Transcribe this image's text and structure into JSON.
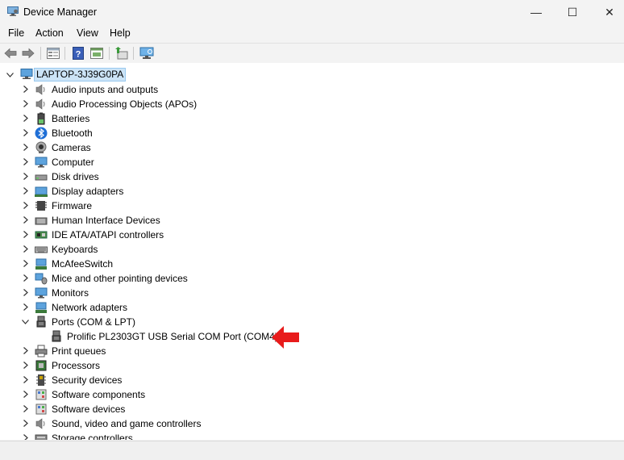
{
  "window": {
    "title": "Device Manager",
    "minimize": "—",
    "maximize": "☐",
    "close": "✕"
  },
  "menu": [
    "File",
    "Action",
    "View",
    "Help"
  ],
  "toolbar": [
    "back-icon",
    "forward-icon",
    "properties-icon",
    "help-icon",
    "driver-icon",
    "update-driver-icon",
    "scan-hardware-icon"
  ],
  "tree": {
    "root": "LAPTOP-3J39G0PA",
    "categories": [
      {
        "label": "Audio inputs and outputs",
        "icon": "speaker-icon",
        "expanded": false
      },
      {
        "label": "Audio Processing Objects (APOs)",
        "icon": "speaker-icon",
        "expanded": false
      },
      {
        "label": "Batteries",
        "icon": "battery-icon",
        "expanded": false
      },
      {
        "label": "Bluetooth",
        "icon": "bluetooth-icon",
        "expanded": false
      },
      {
        "label": "Cameras",
        "icon": "camera-icon",
        "expanded": false
      },
      {
        "label": "Computer",
        "icon": "monitor-icon",
        "expanded": false
      },
      {
        "label": "Disk drives",
        "icon": "disk-icon",
        "expanded": false
      },
      {
        "label": "Display adapters",
        "icon": "display-adapter-icon",
        "expanded": false
      },
      {
        "label": "Firmware",
        "icon": "chip-icon",
        "expanded": false
      },
      {
        "label": "Human Interface Devices",
        "icon": "hid-icon",
        "expanded": false
      },
      {
        "label": "IDE ATA/ATAPI controllers",
        "icon": "controller-icon",
        "expanded": false
      },
      {
        "label": "Keyboards",
        "icon": "keyboard-icon",
        "expanded": false
      },
      {
        "label": "McAfeeSwitch",
        "icon": "network-icon",
        "expanded": false
      },
      {
        "label": "Mice and other pointing devices",
        "icon": "mouse-icon",
        "expanded": false
      },
      {
        "label": "Monitors",
        "icon": "monitor-icon",
        "expanded": false
      },
      {
        "label": "Network adapters",
        "icon": "network-icon",
        "expanded": false
      },
      {
        "label": "Ports (COM & LPT)",
        "icon": "port-icon",
        "expanded": true,
        "children": [
          "Prolific PL2303GT USB Serial COM Port (COM4)"
        ]
      },
      {
        "label": "Print queues",
        "icon": "printer-icon",
        "expanded": false
      },
      {
        "label": "Processors",
        "icon": "processor-icon",
        "expanded": false
      },
      {
        "label": "Security devices",
        "icon": "security-icon",
        "expanded": false
      },
      {
        "label": "Software components",
        "icon": "component-icon",
        "expanded": false
      },
      {
        "label": "Software devices",
        "icon": "component-icon",
        "expanded": false
      },
      {
        "label": "Sound, video and game controllers",
        "icon": "speaker-icon",
        "expanded": false
      },
      {
        "label": "Storage controllers",
        "icon": "storage-icon",
        "expanded": false
      }
    ]
  },
  "colors": {
    "selection": "#cce4f7",
    "arrow": "#e81b1b"
  }
}
